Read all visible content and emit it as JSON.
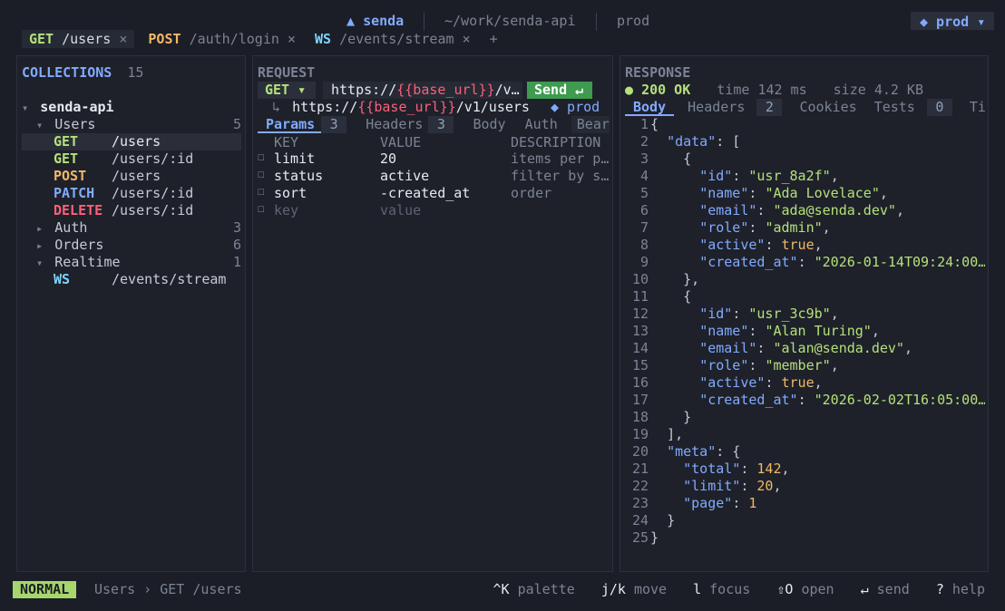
{
  "titlebar": {
    "logo": "▲",
    "app": "senda",
    "path": "~/work/senda-api",
    "env": "prod",
    "env_pill": "◆ prod ▾"
  },
  "tabs": [
    {
      "method": "GET",
      "path": "/users",
      "close": "×"
    },
    {
      "method": "POST",
      "path": "/auth/login",
      "close": "×"
    },
    {
      "method": "WS",
      "path": "/events/stream",
      "close": "×"
    }
  ],
  "new_tab": "+",
  "collections": {
    "title": "COLLECTIONS",
    "count": "15",
    "root": "senda-api",
    "root_arrow": "▾",
    "groups": [
      {
        "arrow": "▾",
        "name": "Users",
        "count": "5"
      },
      {
        "arrow": "▸",
        "name": "Auth",
        "count": "3"
      },
      {
        "arrow": "▸",
        "name": "Orders",
        "count": "6"
      },
      {
        "arrow": "▾",
        "name": "Realtime",
        "count": "1"
      }
    ],
    "users_items": [
      {
        "method": "GET",
        "path": "/users"
      },
      {
        "method": "GET",
        "path": "/users/:id"
      },
      {
        "method": "POST",
        "path": "/users"
      },
      {
        "method": "PATCH",
        "path": "/users/:id"
      },
      {
        "method": "DELETE",
        "path": "/users/:id"
      }
    ],
    "realtime_items": [
      {
        "method": "WS",
        "path": "/events/stream"
      }
    ]
  },
  "request": {
    "title": "REQUEST",
    "method": "GET ▾",
    "url_prefix": "https://",
    "url_var": "{{base_url}}",
    "url_rest": "/v…",
    "send": "Send ↵",
    "resolved_arrow": "↳",
    "resolved_prefix": "https://",
    "resolved_var": "{{base_url}}",
    "resolved_rest": "/v1/users",
    "resolved_env": "◆ prod",
    "tabs": [
      {
        "label": "Params",
        "count": "3"
      },
      {
        "label": "Headers",
        "count": "3"
      },
      {
        "label": "Body"
      },
      {
        "label": "Auth"
      },
      {
        "label": "Bear…"
      }
    ],
    "columns": [
      "KEY",
      "VALUE",
      "DESCRIPTION"
    ],
    "params": [
      {
        "check": "☐",
        "key": "limit",
        "value": "20",
        "desc": "items per p…"
      },
      {
        "check": "☐",
        "key": "status",
        "value": "active",
        "desc": "filter by s…"
      },
      {
        "check": "☐",
        "key": "sort",
        "value": "-created_at",
        "desc": "order"
      },
      {
        "check": "☐",
        "key": "key",
        "value": "value",
        "desc": ""
      }
    ]
  },
  "response": {
    "title": "RESPONSE",
    "status_dot": "●",
    "status": "200 OK",
    "time_label": "time",
    "time": "142 ms",
    "size_label": "size",
    "size": "4.2 KB",
    "tabs": [
      {
        "label": "Body"
      },
      {
        "label": "Headers",
        "count": "2"
      },
      {
        "label": "Cookies"
      },
      {
        "label": "Tests",
        "count": "0"
      },
      {
        "label": "Tim…"
      }
    ],
    "lines": [
      {
        "n": "1",
        "t": [
          [
            "p",
            "{"
          ]
        ]
      },
      {
        "n": "2",
        "t": [
          [
            "s",
            "  "
          ],
          [
            "k",
            "\"data\""
          ],
          [
            "p",
            ": ["
          ]
        ]
      },
      {
        "n": "3",
        "t": [
          [
            "s",
            "    "
          ],
          [
            "p",
            "{"
          ]
        ]
      },
      {
        "n": "4",
        "t": [
          [
            "s",
            "      "
          ],
          [
            "k",
            "\"id\""
          ],
          [
            "p",
            ": "
          ],
          [
            "v",
            "\"usr_8a2f\""
          ],
          [
            "p",
            ","
          ]
        ]
      },
      {
        "n": "5",
        "t": [
          [
            "s",
            "      "
          ],
          [
            "k",
            "\"name\""
          ],
          [
            "p",
            ": "
          ],
          [
            "v",
            "\"Ada Lovelace\""
          ],
          [
            "p",
            ","
          ]
        ]
      },
      {
        "n": "6",
        "t": [
          [
            "s",
            "      "
          ],
          [
            "k",
            "\"email\""
          ],
          [
            "p",
            ": "
          ],
          [
            "v",
            "\"ada@senda.dev\""
          ],
          [
            "p",
            ","
          ]
        ]
      },
      {
        "n": "7",
        "t": [
          [
            "s",
            "      "
          ],
          [
            "k",
            "\"role\""
          ],
          [
            "p",
            ": "
          ],
          [
            "v",
            "\"admin\""
          ],
          [
            "p",
            ","
          ]
        ]
      },
      {
        "n": "8",
        "t": [
          [
            "s",
            "      "
          ],
          [
            "k",
            "\"active\""
          ],
          [
            "p",
            ": "
          ],
          [
            "b",
            "true"
          ],
          [
            "p",
            ","
          ]
        ]
      },
      {
        "n": "9",
        "t": [
          [
            "s",
            "      "
          ],
          [
            "k",
            "\"created_at\""
          ],
          [
            "p",
            ": "
          ],
          [
            "v",
            "\"2026-01-14T09:24:00…"
          ]
        ]
      },
      {
        "n": "10",
        "t": [
          [
            "s",
            "    "
          ],
          [
            "p",
            "},"
          ]
        ]
      },
      {
        "n": "11",
        "t": [
          [
            "s",
            "    "
          ],
          [
            "p",
            "{"
          ]
        ]
      },
      {
        "n": "12",
        "t": [
          [
            "s",
            "      "
          ],
          [
            "k",
            "\"id\""
          ],
          [
            "p",
            ": "
          ],
          [
            "v",
            "\"usr_3c9b\""
          ],
          [
            "p",
            ","
          ]
        ]
      },
      {
        "n": "13",
        "t": [
          [
            "s",
            "      "
          ],
          [
            "k",
            "\"name\""
          ],
          [
            "p",
            ": "
          ],
          [
            "v",
            "\"Alan Turing\""
          ],
          [
            "p",
            ","
          ]
        ]
      },
      {
        "n": "14",
        "t": [
          [
            "s",
            "      "
          ],
          [
            "k",
            "\"email\""
          ],
          [
            "p",
            ": "
          ],
          [
            "v",
            "\"alan@senda.dev\""
          ],
          [
            "p",
            ","
          ]
        ]
      },
      {
        "n": "15",
        "t": [
          [
            "s",
            "      "
          ],
          [
            "k",
            "\"role\""
          ],
          [
            "p",
            ": "
          ],
          [
            "v",
            "\"member\""
          ],
          [
            "p",
            ","
          ]
        ]
      },
      {
        "n": "16",
        "t": [
          [
            "s",
            "      "
          ],
          [
            "k",
            "\"active\""
          ],
          [
            "p",
            ": "
          ],
          [
            "b",
            "true"
          ],
          [
            "p",
            ","
          ]
        ]
      },
      {
        "n": "17",
        "t": [
          [
            "s",
            "      "
          ],
          [
            "k",
            "\"created_at\""
          ],
          [
            "p",
            ": "
          ],
          [
            "v",
            "\"2026-02-02T16:05:00…"
          ]
        ]
      },
      {
        "n": "18",
        "t": [
          [
            "s",
            "    "
          ],
          [
            "p",
            "}"
          ]
        ]
      },
      {
        "n": "19",
        "t": [
          [
            "s",
            "  "
          ],
          [
            "p",
            "],"
          ]
        ]
      },
      {
        "n": "20",
        "t": [
          [
            "s",
            "  "
          ],
          [
            "k",
            "\"meta\""
          ],
          [
            "p",
            ": {"
          ]
        ]
      },
      {
        "n": "21",
        "t": [
          [
            "s",
            "    "
          ],
          [
            "k",
            "\"total\""
          ],
          [
            "p",
            ": "
          ],
          [
            "b",
            "142"
          ],
          [
            "p",
            ","
          ]
        ]
      },
      {
        "n": "22",
        "t": [
          [
            "s",
            "    "
          ],
          [
            "k",
            "\"limit\""
          ],
          [
            "p",
            ": "
          ],
          [
            "b",
            "20"
          ],
          [
            "p",
            ","
          ]
        ]
      },
      {
        "n": "23",
        "t": [
          [
            "s",
            "    "
          ],
          [
            "k",
            "\"page\""
          ],
          [
            "p",
            ": "
          ],
          [
            "b",
            "1"
          ]
        ]
      },
      {
        "n": "24",
        "t": [
          [
            "s",
            "  "
          ],
          [
            "p",
            "}"
          ]
        ]
      },
      {
        "n": "25",
        "t": [
          [
            "p",
            "}"
          ]
        ]
      }
    ]
  },
  "statusbar": {
    "mode": "NORMAL",
    "breadcrumb": "Users › GET /users",
    "hints": [
      {
        "key": "^K",
        "label": "palette"
      },
      {
        "key": "j/k",
        "label": "move"
      },
      {
        "key": "l",
        "label": "focus"
      },
      {
        "key": "⇧O",
        "label": "open"
      },
      {
        "key": "↵",
        "label": "send"
      },
      {
        "key": "?",
        "label": "help"
      }
    ]
  },
  "colors": {
    "GET": "#b5e07a",
    "POST": "#f2b866",
    "PATCH": "#82aaff",
    "DELETE": "#ff5f7a",
    "WS": "#7fd4ff",
    "accent": "#82aaff",
    "send_bg": "#3f9b4f",
    "mode_bg": "#a6d66c",
    "json_key": "#82aaff",
    "json_string": "#b5e07a",
    "json_literal": "#f2b866",
    "url_var": "#ff5f7a"
  }
}
